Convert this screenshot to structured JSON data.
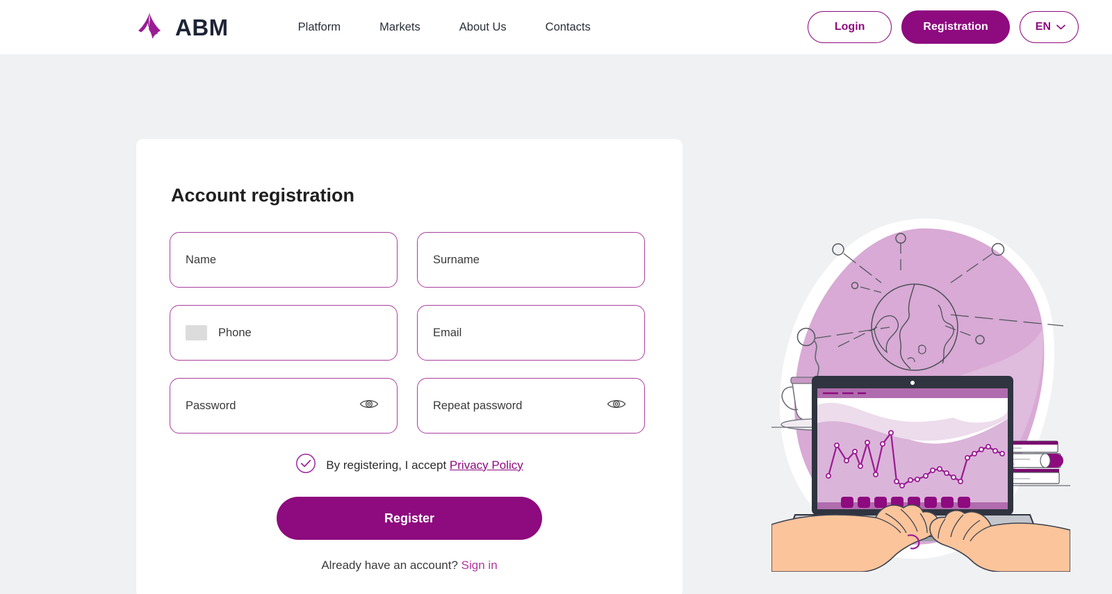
{
  "brand": {
    "logo_icon": "abm-triangle-logo-icon",
    "name": "ABM",
    "accent_color": "#8e0a7f",
    "logo_purple": "#9b1d95",
    "logo_text_color": "#1d2436"
  },
  "header": {
    "nav": [
      {
        "label": "Platform"
      },
      {
        "label": "Markets"
      },
      {
        "label": "About Us"
      },
      {
        "label": "Contacts"
      }
    ],
    "login_label": "Login",
    "registration_label": "Registration",
    "language": "EN",
    "language_chevron_icon": "chevron-down-icon"
  },
  "form": {
    "title": "Account registration",
    "fields": [
      {
        "name": "name",
        "label": "Name",
        "placeholder": "Name",
        "value": "",
        "icon": null
      },
      {
        "name": "surname",
        "label": "Surname",
        "placeholder": "Surname",
        "value": "",
        "icon": null
      },
      {
        "name": "phone",
        "label": "Phone",
        "placeholder": "Phone",
        "value": "",
        "icon": "flag-selector-icon"
      },
      {
        "name": "email",
        "label": "Email",
        "placeholder": "Email",
        "value": "",
        "icon": null
      },
      {
        "name": "password",
        "label": "Password",
        "placeholder": "Password",
        "value": "",
        "icon": "eye-icon"
      },
      {
        "name": "repeat_password",
        "label": "Repeat password",
        "placeholder": "Repeat password",
        "value": "",
        "icon": "eye-icon"
      }
    ],
    "consent": {
      "checked": true,
      "check_icon": "check-circle-icon",
      "text": "By registering, I accept",
      "link_label": "Privacy Policy"
    },
    "submit_label": "Register",
    "footer_text": "Already have an account?",
    "footer_link_label": "Sign in"
  },
  "illustration": {
    "name": "person-using-laptop-with-analytics-chart-illustration",
    "blob_color": "#d5a8d2",
    "accent_color": "#8e0a7f",
    "skin_color": "#fbc49b",
    "elements": [
      "globe-icon",
      "network-nodes",
      "laptop",
      "line-chart-on-screen",
      "hands-typing",
      "coffee-cup",
      "book-stack"
    ]
  },
  "colors": {
    "page_background": "#f0f1f3",
    "header_background": "#ffffff",
    "card_background": "#ffffff",
    "field_border": "#a83f9e"
  }
}
